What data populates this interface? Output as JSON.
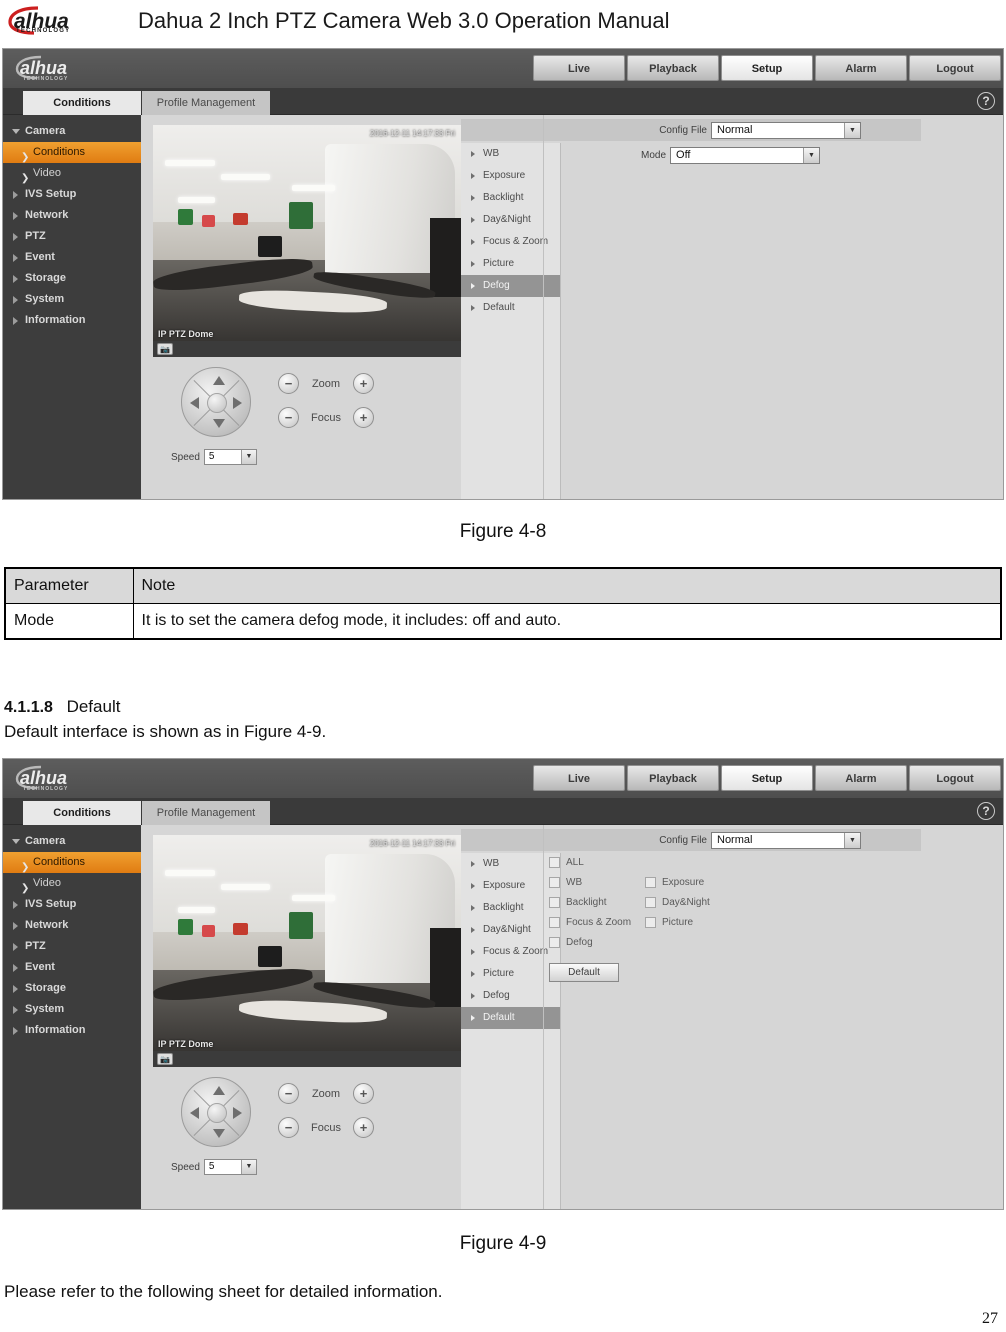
{
  "document": {
    "title": "Dahua 2 Inch PTZ Camera Web 3.0 Operation Manual",
    "brand": "alhua",
    "brand_sub": "TECHNOLOGY",
    "page_number": "27"
  },
  "figure1": {
    "caption": "Figure 4-8",
    "nav": [
      {
        "label": "Live",
        "active": false
      },
      {
        "label": "Playback",
        "active": false
      },
      {
        "label": "Setup",
        "active": true
      },
      {
        "label": "Alarm",
        "active": false
      },
      {
        "label": "Logout",
        "active": false
      }
    ],
    "tabs": [
      {
        "label": "Conditions",
        "selected": true
      },
      {
        "label": "Profile Management",
        "selected": false
      }
    ],
    "help_icon": "?",
    "sidebar": [
      {
        "label": "Camera",
        "type": "group-open",
        "selected": false
      },
      {
        "label": "Conditions",
        "type": "sub",
        "selected": true
      },
      {
        "label": "Video",
        "type": "sub",
        "selected": false
      },
      {
        "label": "IVS Setup",
        "type": "group",
        "selected": false
      },
      {
        "label": "Network",
        "type": "group",
        "selected": false
      },
      {
        "label": "PTZ",
        "type": "group",
        "selected": false
      },
      {
        "label": "Event",
        "type": "group",
        "selected": false
      },
      {
        "label": "Storage",
        "type": "group",
        "selected": false
      },
      {
        "label": "System",
        "type": "group",
        "selected": false
      },
      {
        "label": "Information",
        "type": "group",
        "selected": false
      }
    ],
    "video": {
      "timestamp": "2016-12-11 14:17:33 Fri",
      "channel_name": "IP PTZ Dome",
      "snapshot_icon": "camera-icon"
    },
    "ptz": {
      "zoom_label": "Zoom",
      "focus_label": "Focus",
      "minus": "−",
      "plus": "+",
      "speed_label": "Speed",
      "speed_value": "5"
    },
    "submenu": [
      {
        "label": "WB",
        "selected": false
      },
      {
        "label": "Exposure",
        "selected": false
      },
      {
        "label": "Backlight",
        "selected": false
      },
      {
        "label": "Day&Night",
        "selected": false
      },
      {
        "label": "Focus & Zoom",
        "selected": false
      },
      {
        "label": "Picture",
        "selected": false
      },
      {
        "label": "Defog",
        "selected": true
      },
      {
        "label": "Default",
        "selected": false
      }
    ],
    "config": {
      "config_file_label": "Config File",
      "config_file_value": "Normal",
      "mode_label": "Mode",
      "mode_value": "Off"
    }
  },
  "table1": {
    "headers": [
      "Parameter",
      "Note"
    ],
    "rows": [
      [
        "Mode",
        "It is to set the camera defog mode, it includes: off and auto."
      ]
    ]
  },
  "section": {
    "number": "4.1.1.8",
    "title": "Default",
    "intro": "Default interface is shown as in Figure 4-9."
  },
  "figure2": {
    "caption": "Figure 4-9",
    "nav": [
      {
        "label": "Live",
        "active": false
      },
      {
        "label": "Playback",
        "active": false
      },
      {
        "label": "Setup",
        "active": true
      },
      {
        "label": "Alarm",
        "active": false
      },
      {
        "label": "Logout",
        "active": false
      }
    ],
    "tabs": [
      {
        "label": "Conditions",
        "selected": true
      },
      {
        "label": "Profile Management",
        "selected": false
      }
    ],
    "help_icon": "?",
    "sidebar": [
      {
        "label": "Camera",
        "type": "group-open",
        "selected": false
      },
      {
        "label": "Conditions",
        "type": "sub",
        "selected": true
      },
      {
        "label": "Video",
        "type": "sub",
        "selected": false
      },
      {
        "label": "IVS Setup",
        "type": "group",
        "selected": false
      },
      {
        "label": "Network",
        "type": "group",
        "selected": false
      },
      {
        "label": "PTZ",
        "type": "group",
        "selected": false
      },
      {
        "label": "Event",
        "type": "group",
        "selected": false
      },
      {
        "label": "Storage",
        "type": "group",
        "selected": false
      },
      {
        "label": "System",
        "type": "group",
        "selected": false
      },
      {
        "label": "Information",
        "type": "group",
        "selected": false
      }
    ],
    "video": {
      "timestamp": "2016-12-11 14:17:33 Fri",
      "channel_name": "IP PTZ Dome",
      "snapshot_icon": "camera-icon"
    },
    "ptz": {
      "zoom_label": "Zoom",
      "focus_label": "Focus",
      "minus": "−",
      "plus": "+",
      "speed_label": "Speed",
      "speed_value": "5"
    },
    "submenu": [
      {
        "label": "WB",
        "selected": false
      },
      {
        "label": "Exposure",
        "selected": false
      },
      {
        "label": "Backlight",
        "selected": false
      },
      {
        "label": "Day&Night",
        "selected": false
      },
      {
        "label": "Focus & Zoom",
        "selected": false
      },
      {
        "label": "Picture",
        "selected": false
      },
      {
        "label": "Defog",
        "selected": false
      },
      {
        "label": "Default",
        "selected": true
      }
    ],
    "config": {
      "config_file_label": "Config File",
      "config_file_value": "Normal"
    },
    "checkboxes": [
      {
        "label": "ALL",
        "checked": false
      },
      {
        "label": "WB",
        "checked": false
      },
      {
        "label": "Exposure",
        "checked": false
      },
      {
        "label": "Backlight",
        "checked": false
      },
      {
        "label": "Day&Night",
        "checked": false
      },
      {
        "label": "Focus & Zoom",
        "checked": false
      },
      {
        "label": "Picture",
        "checked": false
      },
      {
        "label": "Defog",
        "checked": false
      }
    ],
    "default_button": "Default"
  },
  "footer_text": "Please refer to the following sheet for detailed information.",
  "colors": {
    "accent_orange": "#e8881a",
    "sidebar_bg": "#3d3d3d",
    "panel_bg": "#d6d6d6",
    "brand_red": "#cc1f1f"
  }
}
